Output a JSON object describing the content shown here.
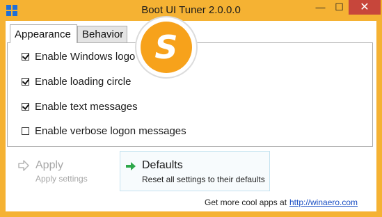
{
  "window": {
    "title": "Boot UI Tuner 2.0.0.0",
    "close_glyph": "✕",
    "minimize_glyph": "—",
    "maximize_glyph": "☐"
  },
  "tabs": [
    {
      "label": "Appearance",
      "active": true
    },
    {
      "label": "Behavior",
      "active": false
    }
  ],
  "options": [
    {
      "label": "Enable Windows logo",
      "checked": true
    },
    {
      "label": "Enable loading circle",
      "checked": true
    },
    {
      "label": "Enable text messages",
      "checked": true
    },
    {
      "label": "Enable verbose logon messages",
      "checked": false
    }
  ],
  "actions": {
    "apply": {
      "title": "Apply",
      "subtitle": "Apply settings",
      "enabled": false
    },
    "defaults": {
      "title": "Defaults",
      "subtitle": "Reset all settings to their defaults"
    }
  },
  "footer": {
    "text": "Get more cool apps at",
    "link": "http://winaero.com"
  },
  "colors": {
    "frame": "#f5b233",
    "close_button": "#c7463b",
    "accent_green": "#2ea84a",
    "link": "#1a4fc4"
  },
  "watermark": {
    "letter": "S"
  }
}
